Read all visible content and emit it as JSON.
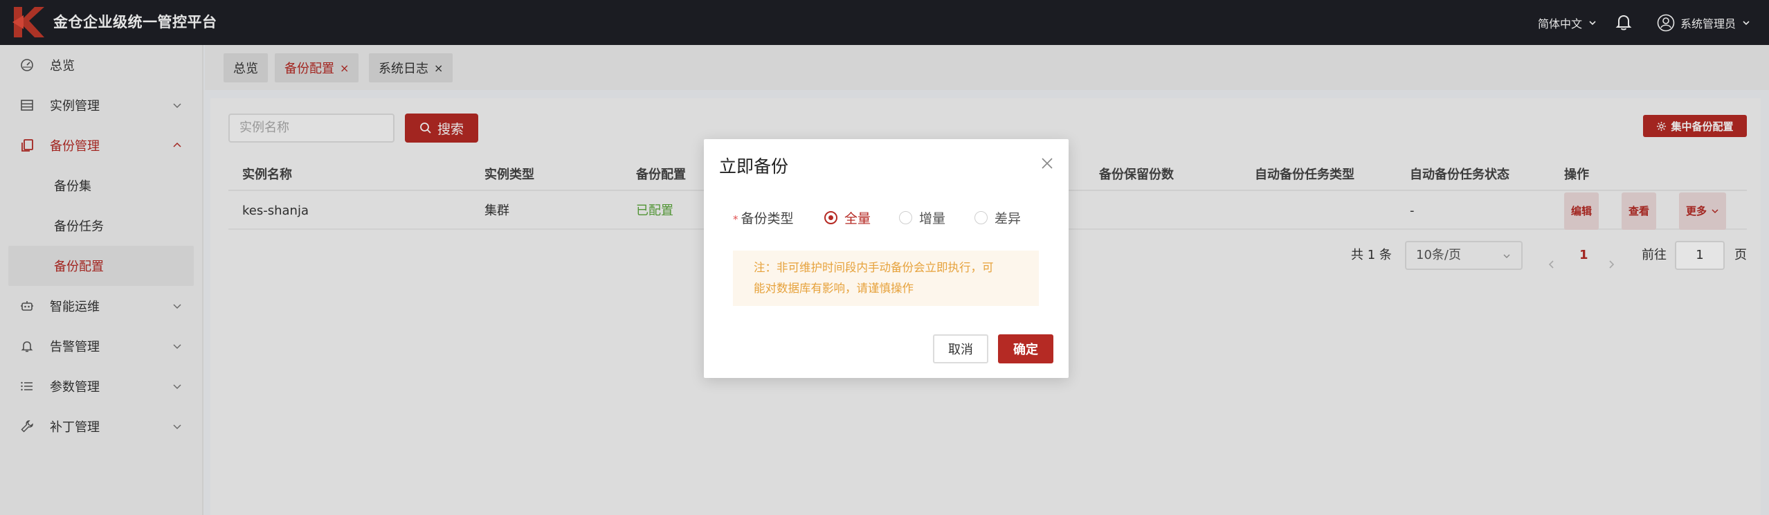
{
  "header": {
    "title": "金仓企业级统一管控平台",
    "language": "简体中文",
    "user": "系统管理员"
  },
  "sidebar": {
    "items": [
      {
        "label": "总览",
        "icon": "dashboard-icon"
      },
      {
        "label": "实例管理",
        "icon": "list-icon"
      },
      {
        "label": "备份管理",
        "icon": "copy-icon",
        "open": true
      },
      {
        "label": "备份集"
      },
      {
        "label": "备份任务"
      },
      {
        "label": "备份配置",
        "active": true
      },
      {
        "label": "智能运维",
        "icon": "robot-icon"
      },
      {
        "label": "告警管理",
        "icon": "bell-icon"
      },
      {
        "label": "参数管理",
        "icon": "menu-list-icon"
      },
      {
        "label": "补丁管理",
        "icon": "wrench-icon"
      }
    ]
  },
  "tabs": [
    {
      "label": "总览"
    },
    {
      "label": "备份配置",
      "active": true,
      "close": "×"
    },
    {
      "label": "系统日志",
      "close": "×"
    }
  ],
  "toolbar": {
    "search_placeholder": "实例名称",
    "search_label": "搜索",
    "centralized_backup_label": "集中备份配置"
  },
  "table": {
    "columns": [
      "实例名称",
      "实例类型",
      "备份配置",
      "备份保留份数",
      "自动备份任务类型",
      "自动备份任务状态",
      "操作"
    ],
    "rows": [
      {
        "name": "kes-shanja",
        "type": "集群",
        "config": "已配置",
        "status": "-"
      }
    ],
    "actions": [
      "编辑",
      "查看",
      "更多"
    ]
  },
  "pagination": {
    "total": "共 1 条",
    "page_size": "10条/页",
    "current_page": "1",
    "goto_label": "前往",
    "goto_value": "1",
    "page_suffix": "页"
  },
  "modal": {
    "title": "立即备份",
    "field_label": "备份类型",
    "required_mark": "*",
    "options": [
      "全量",
      "增量",
      "差异"
    ],
    "selected": "全量",
    "notice_line1": "注：非可维护时间段内手动备份会立即执行，可",
    "notice_line2": "能对数据库有影响，请谨慎操作",
    "cancel_label": "取消",
    "confirm_label": "确定"
  },
  "colors": {
    "brand": "#b52a24",
    "header_bg": "#1f2026",
    "success": "#5aa53a",
    "warning": "#e6a23c"
  }
}
